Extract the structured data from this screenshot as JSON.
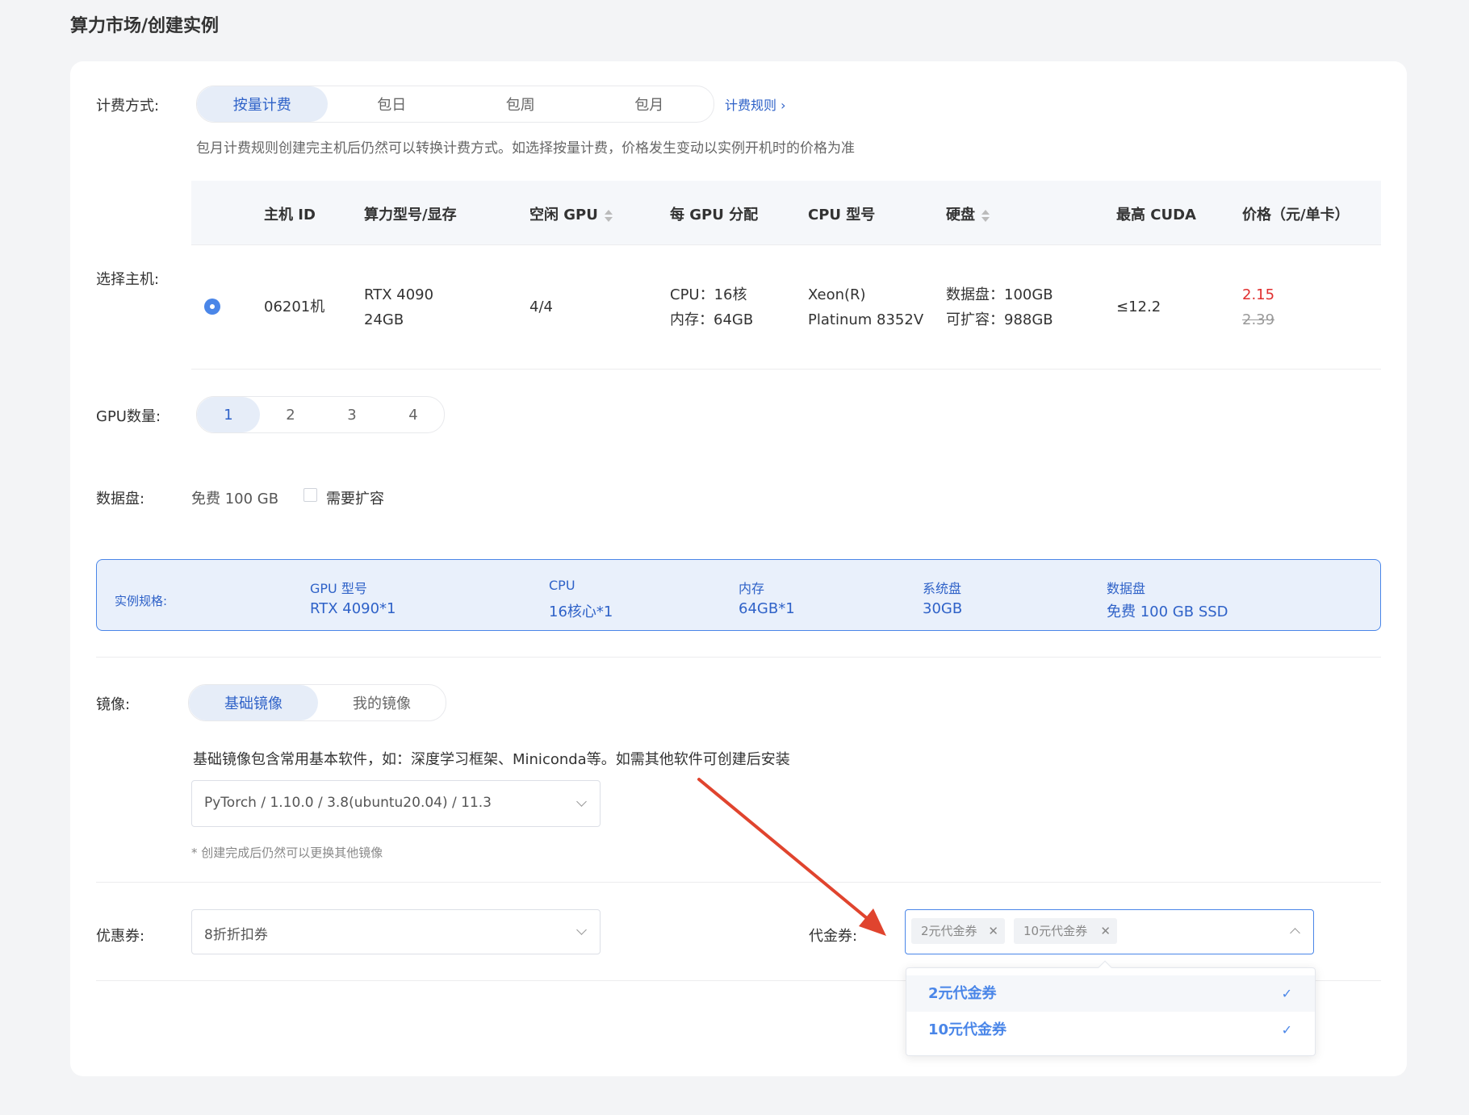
{
  "breadcrumb": "算力市场/创建实例",
  "billing": {
    "label": "计费方式:",
    "options": [
      "按量计费",
      "包日",
      "包周",
      "包月"
    ],
    "selected": "按量计费",
    "rules_link": "计费规则",
    "note": "包月计费规则创建完主机后仍然可以转换计费方式。如选择按量计费，价格发生变动以实例开机时的价格为准"
  },
  "host": {
    "label": "选择主机:",
    "columns": [
      "主机 ID",
      "算力型号/显存",
      "空闲 GPU",
      "每 GPU 分配",
      "CPU 型号",
      "硬盘",
      "最高 CUDA",
      "价格（元/单卡）"
    ],
    "row": {
      "id": "06201机",
      "model": "RTX 4090",
      "vram": "24GB",
      "free_gpu": "4/4",
      "alloc_cpu": "CPU：16核",
      "alloc_mem": "内存：64GB",
      "cpu_model_1": "Xeon(R)",
      "cpu_model_2": "Platinum 8352V",
      "disk_data": "数据盘：100GB",
      "disk_expand": "可扩容：988GB",
      "cuda": "≤12.2",
      "price": "2.15",
      "price_original": "2.39"
    }
  },
  "gpu_count": {
    "label": "GPU数量:",
    "options": [
      "1",
      "2",
      "3",
      "4"
    ],
    "selected": "1"
  },
  "data_disk": {
    "label": "数据盘:",
    "free": "免费 100 GB",
    "expand_label": "需要扩容"
  },
  "spec": {
    "label": "实例规格:",
    "items": [
      {
        "k": "GPU 型号",
        "v": "RTX 4090*1"
      },
      {
        "k": "CPU",
        "v": "16核心*1"
      },
      {
        "k": "内存",
        "v": "64GB*1"
      },
      {
        "k": "系统盘",
        "v": "30GB"
      },
      {
        "k": "数据盘",
        "v": "免费 100 GB SSD"
      }
    ]
  },
  "image": {
    "label": "镜像:",
    "tabs": [
      "基础镜像",
      "我的镜像"
    ],
    "selected": "基础镜像",
    "desc": "基础镜像包含常用基本软件，如：深度学习框架、Miniconda等。如需其他软件可创建后安装",
    "value": "PyTorch / 1.10.0 / 3.8(ubuntu20.04) / 11.3",
    "note": "* 创建完成后仍然可以更换其他镜像"
  },
  "coupon": {
    "label": "优惠券:",
    "value": "8折折扣券"
  },
  "voucher": {
    "label": "代金券:",
    "tags": [
      "2元代金券",
      "10元代金券"
    ],
    "options": [
      "2元代金券",
      "10元代金券"
    ]
  },
  "colors": {
    "accent": "#2f62c8",
    "price_red": "#e02e2e",
    "arrow": "#e0442e"
  }
}
